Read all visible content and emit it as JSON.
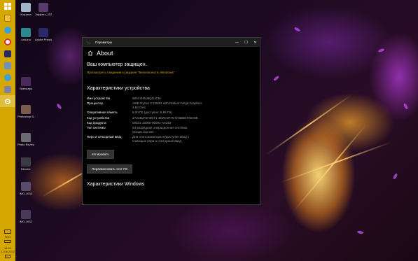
{
  "desktop": {
    "icons": [
      {
        "label": "Корзина",
        "color": "#9fb5c8"
      },
      {
        "label": "Эффект_2023...",
        "color": "#5a3a6a"
      },
      {
        "label": "Arduino",
        "color": "#2a8a8f"
      },
      {
        "label": "Adobe Premiere...",
        "color": "#2a2a66"
      },
      {
        "label": "Премьера",
        "color": "#4a2a5a"
      },
      {
        "label": "Photoshop Scatter",
        "color": "#7a5a4a"
      },
      {
        "label": "Photo Review",
        "color": "#6a6a70"
      },
      {
        "label": "Blender",
        "color": "#3a3a44"
      },
      {
        "label": "IMG_0013",
        "color": "#5a4a6a"
      },
      {
        "label": "IMG_0012",
        "color": "#4a3a5a"
      }
    ]
  },
  "taskbar": {
    "apps": [
      {
        "icon": "windows-start-icon",
        "color": "#ffffff"
      },
      {
        "icon": "folder-icon",
        "color": "#f0c040"
      },
      {
        "icon": "telegram-icon",
        "color": "#3aa0e0"
      },
      {
        "icon": "yandex-browser-icon",
        "color": "#ffffff"
      },
      {
        "icon": "premiere-icon",
        "color": "#2a2a66"
      },
      {
        "icon": "photos-icon",
        "color": "#7090c0"
      },
      {
        "icon": "web-icon",
        "color": "#40a0d0"
      },
      {
        "icon": "store-icon",
        "color": "#8080a0"
      },
      {
        "icon": "settings-icon",
        "color": "#ffffff"
      }
    ],
    "lang": "ENG",
    "time": "18:41",
    "date": "11.06.2022"
  },
  "window": {
    "title": "Параметры",
    "back": "←",
    "minimize": "—",
    "maximize": "☐",
    "close": "✕",
    "page_title": "About",
    "protected": "Ваш компьютер защищен.",
    "security_link": "Просмотреть сведения в разделе \"Безопасность Windows\"",
    "device_section_title": "Характеристики устройства",
    "specs": [
      {
        "label": "Имя устройства",
        "value": "WIN-3H0U5QGJCM"
      },
      {
        "label": "Процессор",
        "value": "AMD Ryzen 3 2200G with Radeon Vega Graphics      3.50 GHz"
      },
      {
        "label": "Оперативная память",
        "value": "8,00 ГБ (доступно: 5,95 ГБ)"
      },
      {
        "label": "Код устройства",
        "value": "2A4AB2AD-BD71-4D25-8F76-8A5BB4F66A8E"
      },
      {
        "label": "Код продукта",
        "value": "00331-10000-00001-AA253"
      },
      {
        "label": "Тип системы",
        "value": "64-разрядная операционная система, процессор x64"
      },
      {
        "label": "Перо и сенсорный ввод",
        "value": "Для этого монитора недоступен ввод с помощью пера и сенсорный ввод"
      }
    ],
    "copy_button": "Копировать",
    "rename_button": "Переименовать этот ПК",
    "windows_section_title": "Характеристики Windows"
  }
}
